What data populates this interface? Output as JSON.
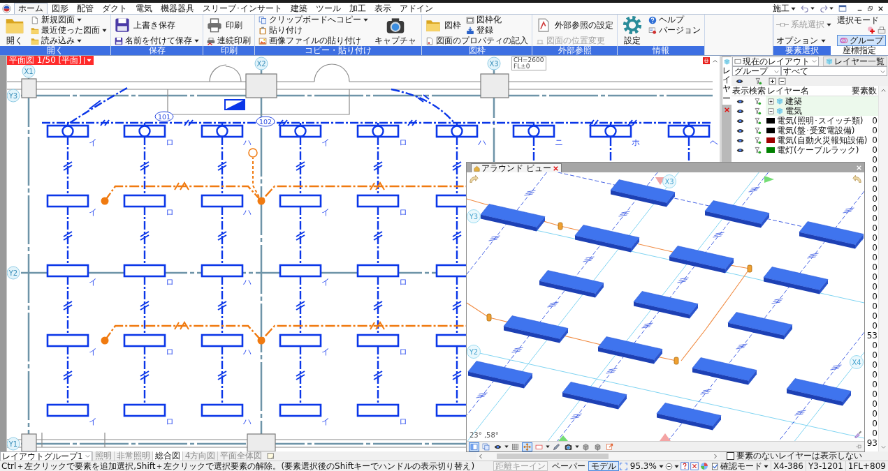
{
  "menu_tabs": [
    {
      "label": "ホーム",
      "selected": true
    },
    {
      "label": "図形",
      "selected": false
    },
    {
      "label": "配管",
      "selected": false
    },
    {
      "label": "ダクト",
      "selected": false
    },
    {
      "label": "電気",
      "selected": false
    },
    {
      "label": "機器器具",
      "selected": false
    },
    {
      "label": "スリーブ･インサート",
      "selected": false
    },
    {
      "label": "建築",
      "selected": false
    },
    {
      "label": "ツール",
      "selected": false
    },
    {
      "label": "加工",
      "selected": false
    },
    {
      "label": "表示",
      "selected": false
    },
    {
      "label": "アドイン",
      "selected": false
    }
  ],
  "quick_access": {
    "mode": "施工"
  },
  "ribbon": {
    "groups": [
      {
        "title": "開く",
        "columns": [
          [
            {
              "kind": "large",
              "label": "開く",
              "dropdown": false,
              "disabled": false
            }
          ],
          [
            {
              "kind": "small",
              "label": "新規図面",
              "dropdown": true,
              "disabled": false
            },
            {
              "kind": "small",
              "label": "最近使った図面",
              "dropdown": true,
              "disabled": false
            },
            {
              "kind": "small",
              "label": "読み込み",
              "dropdown": true,
              "disabled": false
            }
          ]
        ]
      },
      {
        "title": "保存",
        "columns": [
          [
            {
              "kind": "medium",
              "label": "上書き保存",
              "dropdown": false,
              "disabled": false
            },
            {
              "kind": "small",
              "label": "名前を付けて保存",
              "dropdown": true,
              "disabled": false
            }
          ]
        ]
      },
      {
        "title": "印刷",
        "columns": [
          [
            {
              "kind": "medium",
              "label": "印刷",
              "dropdown": false,
              "disabled": false
            },
            {
              "kind": "small",
              "label": "連続印刷",
              "dropdown": false,
              "disabled": false
            }
          ]
        ]
      },
      {
        "title": "コピー・貼り付け",
        "columns": [
          [
            {
              "kind": "small",
              "label": "クリップボードへコピー",
              "dropdown": true,
              "disabled": false
            },
            {
              "kind": "small",
              "label": "貼り付け",
              "dropdown": false,
              "disabled": false
            },
            {
              "kind": "small",
              "label": "画像ファイルの貼り付け",
              "dropdown": false,
              "disabled": false
            }
          ],
          [
            {
              "kind": "large",
              "label": "キャプチャ",
              "dropdown": false,
              "disabled": false
            }
          ]
        ]
      },
      {
        "title": "図枠",
        "columns": [
          [
            {
              "kind": "medium",
              "label": "図枠",
              "dropdown": false,
              "disabled": false
            }
          ],
          [
            {
              "kind": "small",
              "label": "図枠化",
              "dropdown": false,
              "disabled": false
            },
            {
              "kind": "small",
              "label": "登録",
              "dropdown": false,
              "disabled": false
            }
          ]
        ],
        "bottom": [
          {
            "kind": "small",
            "label": "図面のプロパティの記入",
            "dropdown": false,
            "disabled": false
          }
        ]
      },
      {
        "title": "外部参照",
        "columns": [
          [
            {
              "kind": "medium",
              "label": "外部参照の設定",
              "dropdown": false,
              "disabled": false
            },
            {
              "kind": "small",
              "label": "図面の位置変更",
              "dropdown": false,
              "disabled": true
            }
          ]
        ]
      },
      {
        "title": "情報",
        "columns": [
          [
            {
              "kind": "large",
              "label": "設定",
              "dropdown": false,
              "disabled": false
            }
          ],
          [
            {
              "kind": "small",
              "label": "ヘルプ",
              "dropdown": false,
              "disabled": false
            },
            {
              "kind": "small",
              "label": "バージョン",
              "dropdown": false,
              "disabled": false
            }
          ]
        ]
      }
    ]
  },
  "selection_panel": {
    "system_select": {
      "label": "系統選択",
      "disabled": true
    },
    "mode_label": "選択モード",
    "options": "オプション",
    "group_button": {
      "label": "グループ",
      "selected": true
    },
    "tabs": [
      {
        "label": "要素選択",
        "selected": true
      },
      {
        "label": "座標指定",
        "selected": false
      }
    ]
  },
  "drawing": {
    "tab": "平面図 1/50 [平面]",
    "x_axes": [
      "X1",
      "X2",
      "X3"
    ],
    "y_axes": [
      "Y3",
      "Y2",
      "Y1"
    ],
    "ceiling_note": [
      "CH=2600",
      "FL±0"
    ],
    "room_tags": [
      "101",
      "102"
    ],
    "circuit_labels": [
      [
        "イ",
        "ロ",
        "ハ",
        "イ",
        "ロ",
        "ハ",
        "ニ",
        "ホ",
        "ヘ"
      ],
      [
        "イ",
        "ロ",
        "ハ",
        "イ",
        "ロ"
      ],
      [
        "イ",
        "ロ",
        "ハ",
        "イ",
        "ロ"
      ],
      [
        "イ",
        "ロ",
        "ハ",
        "イ",
        "ロ"
      ],
      [
        "イ",
        "ロ",
        "ハ",
        "イ",
        "ロ"
      ]
    ]
  },
  "layer_panel": {
    "side_tab": "レイヤー",
    "layout_select": "現在のレイアウト",
    "layer_list_button": "レイヤー一覧",
    "group_select": "グループ",
    "filter_select": "すべて",
    "columns": [
      "表示",
      "検索",
      "レイヤー名",
      "要素数"
    ],
    "layers": [
      {
        "kind": "group",
        "name": "建築",
        "expanded": false
      },
      {
        "kind": "group",
        "name": "電気",
        "expanded": true,
        "children": [
          {
            "kind": "layer",
            "name": "電気(照明･スイッチ類)",
            "color": "#000000",
            "count": "0"
          },
          {
            "kind": "layer",
            "name": "電気(盤･受変電設備)",
            "color": "#000000",
            "count": "0"
          },
          {
            "kind": "layer",
            "name": "電気(自動火災報知設備)",
            "color": "#a00000",
            "count": "0"
          },
          {
            "kind": "layer",
            "name": "電灯(ケーブルラック)",
            "color": "#008000",
            "count": "0"
          },
          {
            "kind": "layer",
            "count": "0"
          },
          {
            "kind": "layer",
            "count": "0"
          },
          {
            "kind": "layer",
            "count": "0"
          },
          {
            "kind": "layer",
            "count": "0"
          },
          {
            "kind": "layer",
            "count": "0"
          },
          {
            "kind": "layer",
            "count": "0"
          },
          {
            "kind": "layer",
            "count": "0"
          },
          {
            "kind": "layer",
            "count": "0"
          },
          {
            "kind": "layer",
            "count": "0"
          },
          {
            "kind": "layer",
            "count": "0"
          },
          {
            "kind": "layer",
            "count": "0"
          },
          {
            "kind": "layer",
            "count": "0"
          },
          {
            "kind": "layer",
            "count": "0"
          },
          {
            "kind": "layer",
            "count": "0"
          },
          {
            "kind": "layer",
            "count": "0"
          },
          {
            "kind": "layer",
            "count": "0"
          },
          {
            "kind": "layer",
            "count": "0"
          },
          {
            "kind": "layer",
            "count": "0"
          },
          {
            "kind": "layer",
            "count": "53"
          },
          {
            "kind": "layer",
            "count": "0"
          },
          {
            "kind": "layer",
            "count": "0"
          },
          {
            "kind": "layer",
            "count": "0"
          },
          {
            "kind": "layer",
            "count": "0"
          },
          {
            "kind": "layer",
            "count": "0"
          },
          {
            "kind": "layer",
            "count": "0"
          },
          {
            "kind": "layer",
            "count": "0"
          },
          {
            "kind": "layer",
            "count": "0"
          },
          {
            "kind": "layer",
            "count": "0"
          },
          {
            "kind": "layer",
            "count": "0"
          },
          {
            "kind": "layer",
            "count": "93"
          }
        ]
      }
    ],
    "hide_empty": {
      "label": "要素のないレイヤーは表示しない",
      "checked": false
    }
  },
  "around_view": {
    "title": "アラウンド ビュー",
    "grid_labels": [
      "X3",
      "Y3",
      "Y2",
      "X4"
    ],
    "angles": "23° ,58°",
    "toolbar": [
      {
        "selected": true
      },
      {
        "selected": false
      },
      {
        "selected": false
      },
      {
        "selected": false
      },
      {
        "selected": true
      },
      {
        "selected": false
      },
      {
        "selected": false
      },
      {
        "selected": false
      },
      {
        "selected": false
      },
      {
        "selected": false
      },
      {
        "selected": false
      }
    ]
  },
  "layout_bar": {
    "group_select": "レイアウトグループ1",
    "tabs": [
      {
        "label": "照明",
        "selected": false
      },
      {
        "label": "非常照明",
        "selected": false
      },
      {
        "label": "総合図",
        "selected": true
      },
      {
        "label": "4方向図",
        "selected": false
      },
      {
        "label": "平面全体図",
        "selected": false
      }
    ]
  },
  "status_bar": {
    "message": "Ctrl＋左クリックで要素を追加選択,Shift＋左クリックで選択要素の解除。(要素選択後のShiftキーでハンドルの表示切り替え)",
    "distance_keyin": {
      "label": "距離キーイン",
      "disabled": true
    },
    "space_tabs": [
      {
        "label": "ペーパー",
        "selected": false
      },
      {
        "label": "モデル",
        "selected": true
      }
    ],
    "zoom": "95.3%",
    "check_mode": "確認モード",
    "coords": [
      "X4-386",
      "Y3-1201",
      "1FL+809"
    ]
  }
}
